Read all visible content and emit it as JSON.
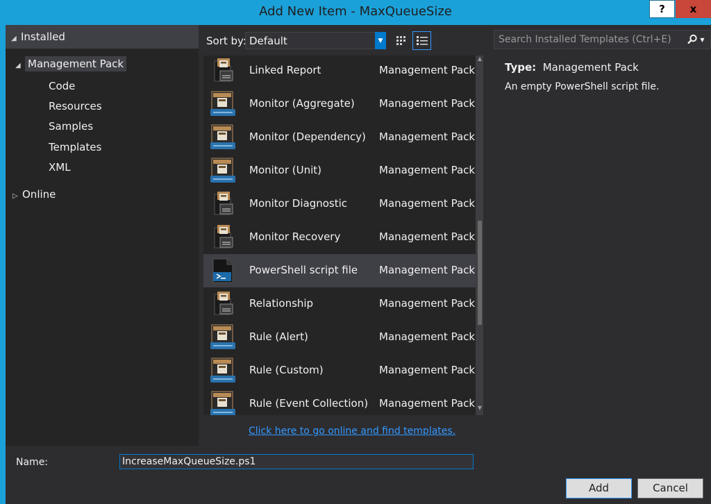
{
  "window": {
    "title": "Add New Item - MaxQueueSize",
    "help_label": "?",
    "close_label": "x"
  },
  "tree": {
    "installed_label": "Installed",
    "management_pack_label": "Management Pack",
    "children": [
      "Code",
      "Resources",
      "Samples",
      "Templates",
      "XML"
    ],
    "online_label": "Online"
  },
  "toolbar": {
    "sort_label": "Sort by:",
    "sort_value": "Default"
  },
  "search": {
    "placeholder": "Search Installed Templates (Ctrl+E)"
  },
  "templates": [
    {
      "name": "Linked Report",
      "category": "Management Pack",
      "icon": "management-pack-template-icon"
    },
    {
      "name": "Monitor (Aggregate)",
      "category": "Management Pack",
      "icon": "monitor-template-icon"
    },
    {
      "name": "Monitor (Dependency)",
      "category": "Management Pack",
      "icon": "monitor-template-icon"
    },
    {
      "name": "Monitor (Unit)",
      "category": "Management Pack",
      "icon": "monitor-template-icon"
    },
    {
      "name": "Monitor Diagnostic",
      "category": "Management Pack",
      "icon": "management-pack-template-icon"
    },
    {
      "name": "Monitor Recovery",
      "category": "Management Pack",
      "icon": "management-pack-template-icon"
    },
    {
      "name": "PowerShell script file",
      "category": "Management Pack",
      "icon": "powershell-script-icon",
      "selected": true
    },
    {
      "name": "Relationship",
      "category": "Management Pack",
      "icon": "management-pack-template-icon"
    },
    {
      "name": "Rule (Alert)",
      "category": "Management Pack",
      "icon": "monitor-template-icon"
    },
    {
      "name": "Rule (Custom)",
      "category": "Management Pack",
      "icon": "monitor-template-icon"
    },
    {
      "name": "Rule (Event Collection)",
      "category": "Management Pack",
      "icon": "monitor-template-icon"
    }
  ],
  "details": {
    "type_label": "Type:",
    "type_value": "Management Pack",
    "description": "An empty PowerShell script file."
  },
  "online_link": "Click here to go online and find templates.",
  "footer": {
    "name_label": "Name:",
    "name_value": "IncreaseMaxQueueSize.ps1",
    "add_label": "Add",
    "cancel_label": "Cancel"
  },
  "colors": {
    "accent": "#007acc",
    "window_frame": "#1ba1d9",
    "selection": "#3f3f46"
  }
}
